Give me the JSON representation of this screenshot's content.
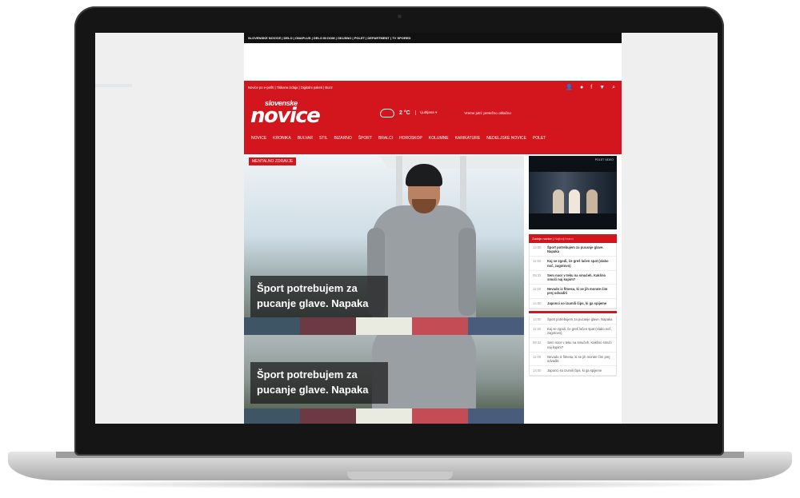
{
  "site": {
    "topbar_links": "SLOVENSKE NOVICE | DELO | ONAPLUS | DELO IN DOM | OKUSNO | POLET | DEPARTMENT | TV SPORED",
    "utility_links": "Novice po e-pošti  |  Tiskana izdaja  |  Digitalni paketi  |  Buzz",
    "logo_top": "slovenske",
    "logo_main": "novice",
    "temperature": "2 °C",
    "city": "Ljubljana ▾",
    "forecast": "Vreme jutri: pretežno oblačno",
    "nav": [
      "NOVICE",
      "KRONIKA",
      "BULVAR",
      "STIL",
      "BIZARNO",
      "ŠPORT",
      "BRALCI",
      "HOROSKOP",
      "KOLUMNE",
      "KARIKATURE",
      "NEDELJSKE NOVICE",
      "POLET"
    ]
  },
  "hero": {
    "tag": "MENTALNO ZDRAVJE",
    "headline_1": "Šport potrebujem za pucanje glave. Napaka",
    "headline_2": "Šport potrebujem za pucanje glave. Napaka"
  },
  "sidebar": {
    "video_label": "POLET VIDEO",
    "tab_active": "Zadnje novice",
    "tab_inactive": "Najbolj brano",
    "items": [
      {
        "time": "13:00",
        "title": "Šport potrebujem za pucanje glave. Napaka"
      },
      {
        "time": "11:50",
        "title": "Kaj se zgodi, če greš lačen spat (slabo noč, zagotovo)"
      },
      {
        "time": "08:32",
        "title": "Sem noor v teku na smučeh. Kakšno smuči naj kupim?"
      },
      {
        "time": "11:00",
        "title": "Nevado iz fitnesa, ki se jih morate čim prej odvaditi"
      },
      {
        "time": "14:00",
        "title": "Japonci so izumili čips, ki ga spijeme"
      }
    ],
    "items_repeat": [
      {
        "time": "13:00",
        "title": "Šport potrebujem za pucanje glave. Napaka"
      },
      {
        "time": "11:50",
        "title": "Kaj se zgodi, če greš lačen spat (slabo noč, zagotovo)"
      },
      {
        "time": "08:32",
        "title": "Sem noor v teku na smučeh. Kakšno smuči naj kupim?"
      },
      {
        "time": "11:00",
        "title": "Nevado iz fitnesa, ki se jih morate čim prej odvaditi"
      },
      {
        "time": "14:00",
        "title": "Japonci so izumili čips, ki ga spijeme"
      }
    ]
  },
  "colors": {
    "brand_red": "#d3161d",
    "topbar_black": "#111111"
  }
}
